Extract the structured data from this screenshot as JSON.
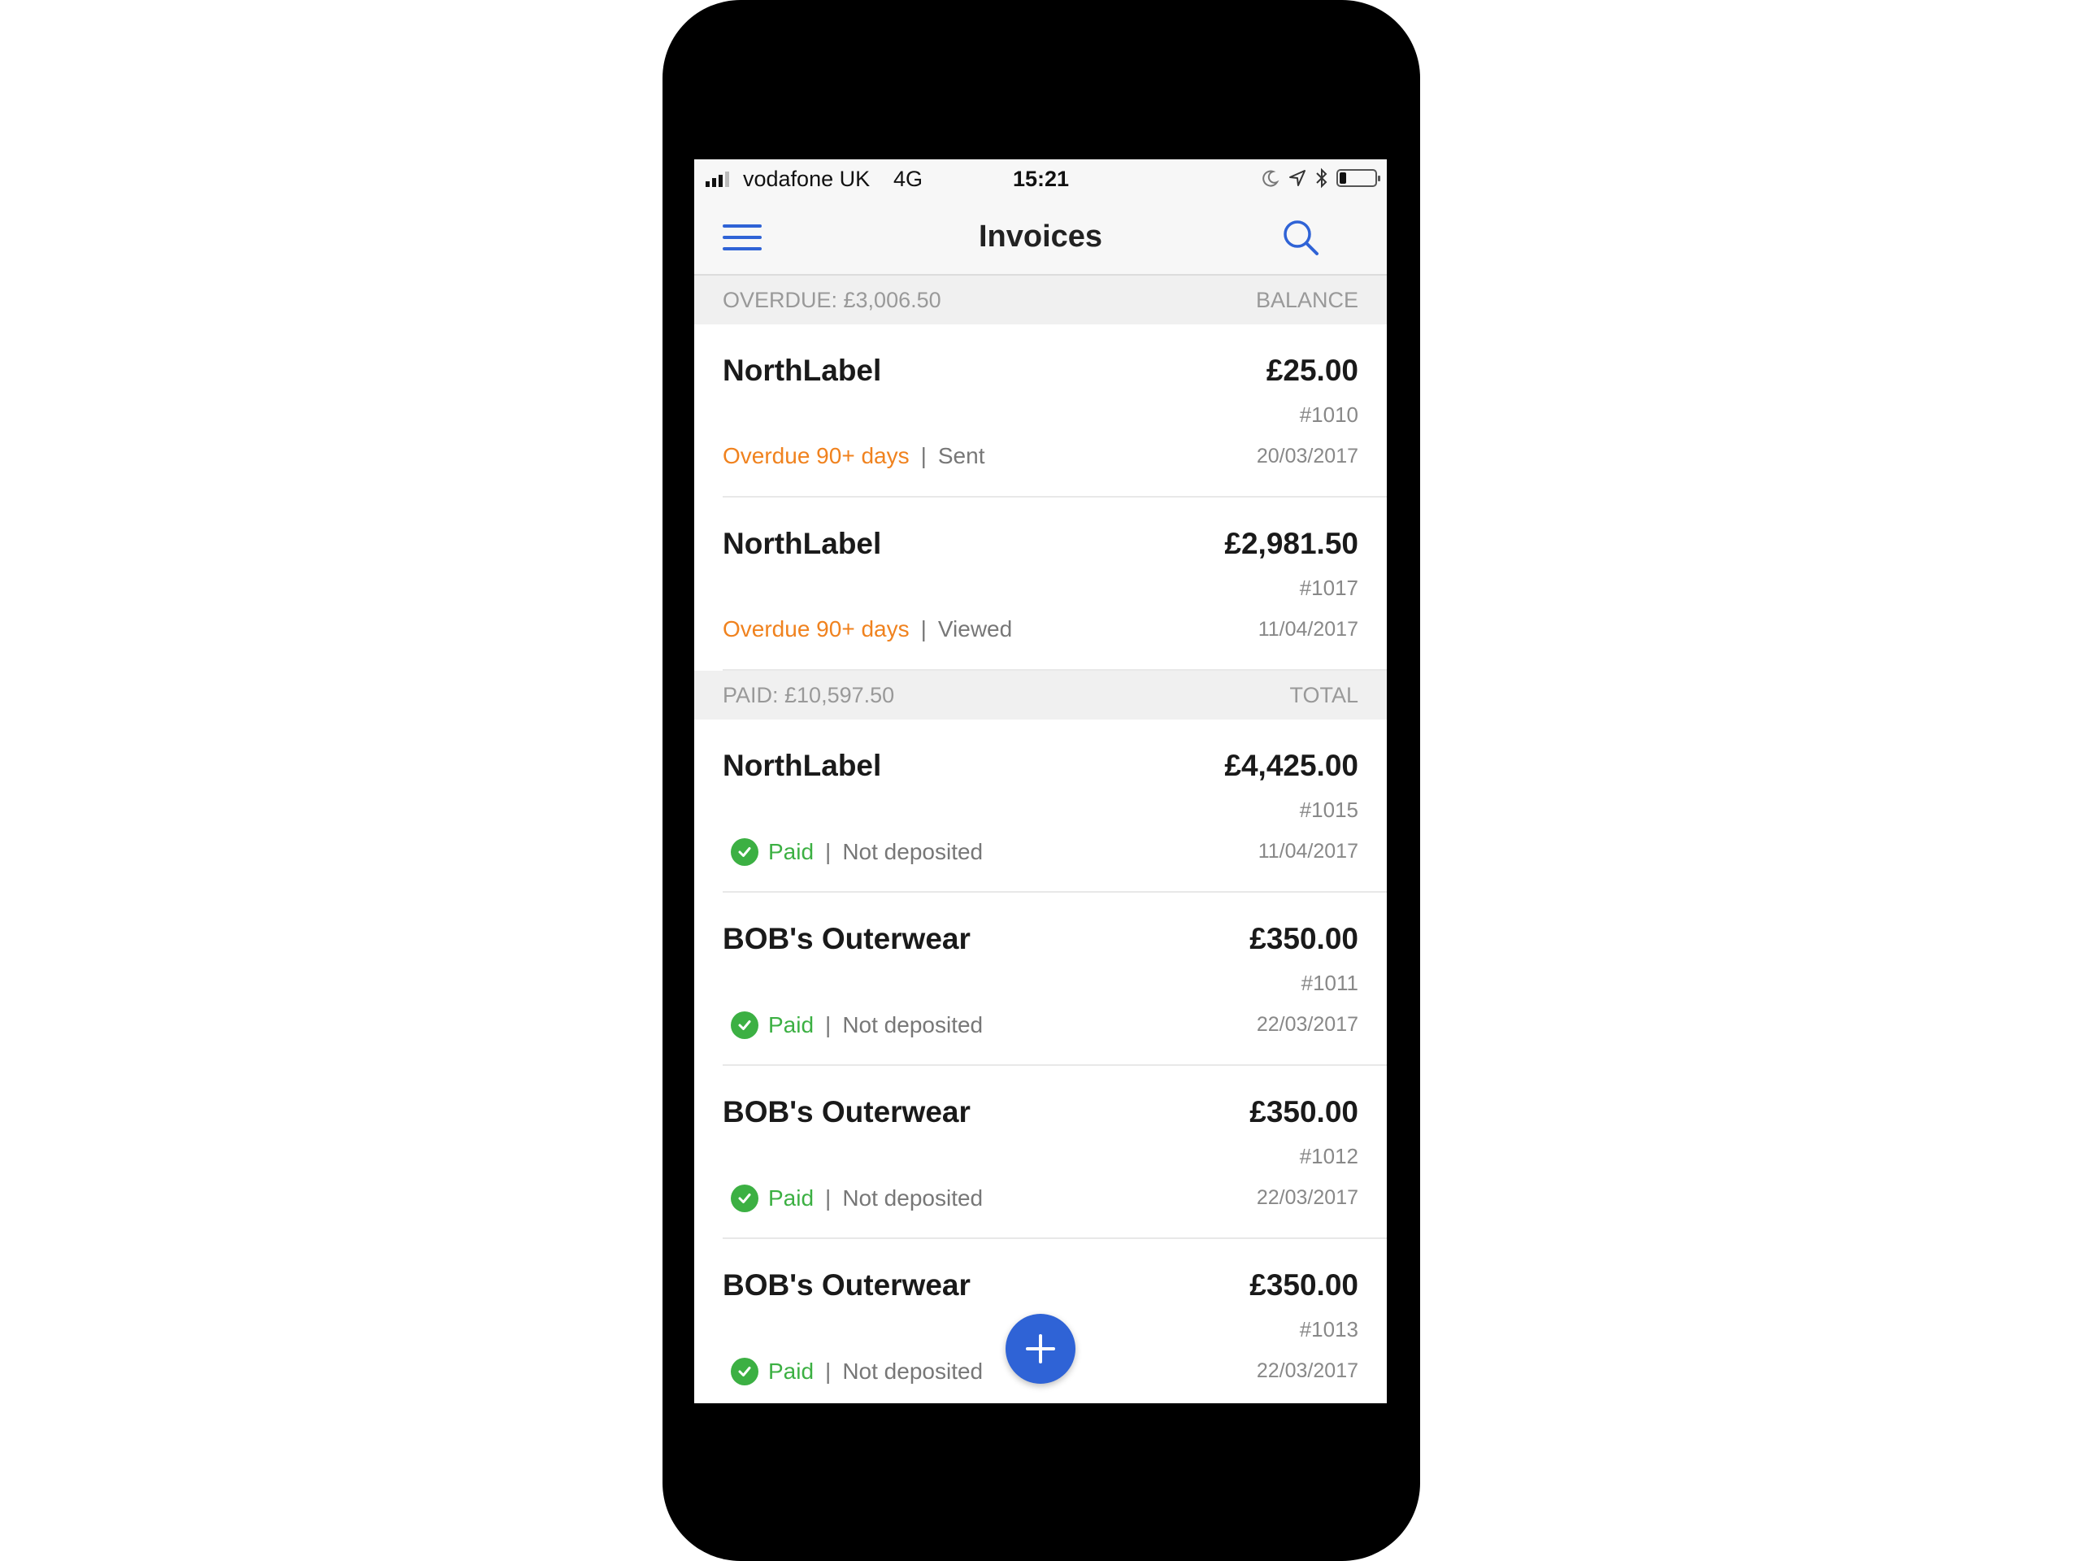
{
  "status_bar": {
    "carrier": "vodafone UK",
    "network": "4G",
    "time": "15:21",
    "battery_level": 0.2
  },
  "nav": {
    "title": "Invoices",
    "menu_icon": "hamburger-menu-icon",
    "search_icon": "search-icon"
  },
  "sections": [
    {
      "label": "OVERDUE: £3,006.50",
      "right_label": "BALANCE",
      "invoices": [
        {
          "customer": "NorthLabel",
          "amount": "£25.00",
          "number": "#1010",
          "date": "20/03/2017",
          "status": "Overdue 90+ days",
          "sub_status": "Sent"
        },
        {
          "customer": "NorthLabel",
          "amount": "£2,981.50",
          "number": "#1017",
          "date": "11/04/2017",
          "status": "Overdue 90+ days",
          "sub_status": "Viewed"
        }
      ]
    },
    {
      "label": "PAID: £10,597.50",
      "right_label": "TOTAL",
      "invoices": [
        {
          "customer": "NorthLabel",
          "amount": "£4,425.00",
          "number": "#1015",
          "date": "11/04/2017",
          "status": "Paid",
          "sub_status": "Not deposited"
        },
        {
          "customer": "BOB's Outerwear",
          "amount": "£350.00",
          "number": "#1011",
          "date": "22/03/2017",
          "status": "Paid",
          "sub_status": "Not deposited"
        },
        {
          "customer": "BOB's Outerwear",
          "amount": "£350.00",
          "number": "#1012",
          "date": "22/03/2017",
          "status": "Paid",
          "sub_status": "Not deposited"
        },
        {
          "customer": "BOB's Outerwear",
          "amount": "£350.00",
          "number": "#1013",
          "date": "22/03/2017",
          "status": "Paid",
          "sub_status": "Not deposited"
        }
      ]
    }
  ],
  "separator": "|",
  "colors": {
    "accent": "#2f63d6",
    "overdue": "#f0821e",
    "paid": "#3cb043"
  }
}
